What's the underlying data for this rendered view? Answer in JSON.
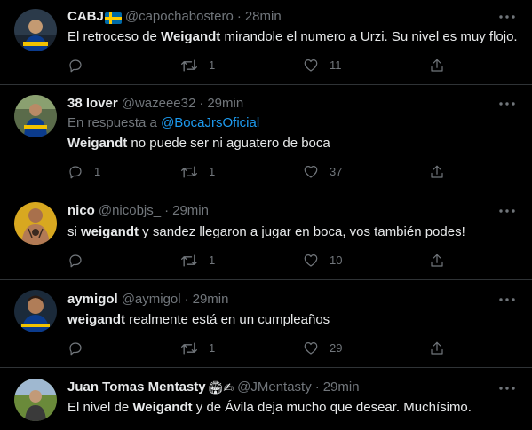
{
  "tweets": [
    {
      "name": "CABJ",
      "handle": "@capochabostero",
      "sep": "·",
      "time": "28min",
      "text": [
        {
          "t": "El retroceso de ",
          "b": false
        },
        {
          "t": "Weigandt",
          "b": true
        },
        {
          "t": " mirandole el numero a Urzi. Su nivel es muy flojo.",
          "b": false
        }
      ],
      "reply_count": "",
      "retweet_count": "1",
      "like_count": "11"
    },
    {
      "name": "38 lover",
      "handle": "@wazeee32",
      "sep": "·",
      "time": "29min",
      "reply_prefix": "En respuesta a ",
      "reply_handle": "@BocaJrsOficial",
      "text": [
        {
          "t": "Weigandt",
          "b": true
        },
        {
          "t": " no puede ser ni aguatero de boca",
          "b": false
        }
      ],
      "reply_count": "1",
      "retweet_count": "1",
      "like_count": "37"
    },
    {
      "name": "nico",
      "handle": "@nicobjs_",
      "sep": "·",
      "time": "29min",
      "text": [
        {
          "t": "si ",
          "b": false
        },
        {
          "t": "weigandt",
          "b": true
        },
        {
          "t": " y sandez llegaron a jugar en boca, vos también podes!",
          "b": false
        }
      ],
      "reply_count": "",
      "retweet_count": "1",
      "like_count": "10"
    },
    {
      "name": "aymigol",
      "handle": "@aymigol",
      "sep": "·",
      "time": "29min",
      "text": [
        {
          "t": "weigandt",
          "b": true
        },
        {
          "t": " realmente está en un cumpleaños",
          "b": false
        }
      ],
      "reply_count": "",
      "retweet_count": "1",
      "like_count": "29"
    },
    {
      "name": "Juan Tomas Mentasty",
      "name_emoji": "🏟✍",
      "handle": "@JMentasty",
      "sep": "·",
      "time": "29min",
      "text": [
        {
          "t": "El nivel de ",
          "b": false
        },
        {
          "t": "Weigandt",
          "b": true
        },
        {
          "t": " y de Ávila deja mucho que desear. Muchísimo.",
          "b": false
        }
      ],
      "reply_count": "",
      "retweet_count": "",
      "like_count": ""
    }
  ],
  "colors": {
    "background": "#000000",
    "text": "#e7e9ea",
    "secondary": "#71767b",
    "link": "#1d9bf0",
    "divider": "#2f3336"
  },
  "icons": {
    "avatar_1": "boca-player-avatar",
    "avatar_2": "boca-player-avatar",
    "avatar_3": "tattooed-person-avatar",
    "avatar_4": "player-portrait-avatar",
    "avatar_5": "man-outdoors-avatar",
    "flag": "sweden-flag-icon",
    "more": "more-dots-icon",
    "reply": "reply-icon",
    "retweet": "retweet-icon",
    "like": "like-icon",
    "share": "share-icon"
  }
}
